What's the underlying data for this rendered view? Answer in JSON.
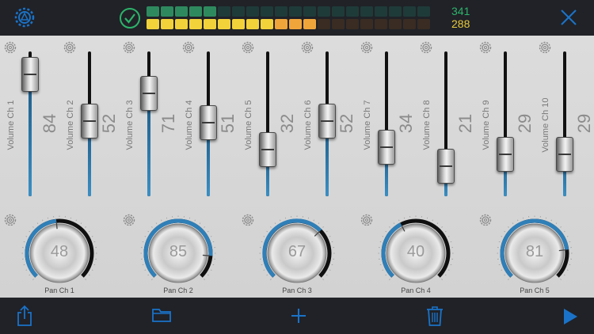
{
  "meter": {
    "top_value": "341",
    "bottom_value": "288",
    "top_count": 5,
    "bottom_count": 12,
    "segments": 20
  },
  "icons": {
    "settings": "settings-wheel-icon",
    "status": "check-circle-icon",
    "close": "close-icon"
  },
  "faders": [
    {
      "label": "Volume Ch 1",
      "value": "84",
      "level": 0.84
    },
    {
      "label": "Volume Ch 2",
      "value": "52",
      "level": 0.52
    },
    {
      "label": "Volume Ch 3",
      "value": "71",
      "level": 0.71
    },
    {
      "label": "Volume Ch 4",
      "value": "51",
      "level": 0.51
    },
    {
      "label": "Volume Ch 5",
      "value": "32",
      "level": 0.32
    },
    {
      "label": "Volume Ch 6",
      "value": "52",
      "level": 0.52
    },
    {
      "label": "Volume Ch 7",
      "value": "34",
      "level": 0.34
    },
    {
      "label": "Volume Ch 8",
      "value": "21",
      "level": 0.21
    },
    {
      "label": "Volume Ch 9",
      "value": "29",
      "level": 0.29
    },
    {
      "label": "Volume Ch 10",
      "value": "29",
      "level": 0.29
    }
  ],
  "knobs": [
    {
      "label": "Pan Ch 1",
      "value": "48",
      "level": 0.48
    },
    {
      "label": "Pan Ch 2",
      "value": "85",
      "level": 0.85
    },
    {
      "label": "Pan Ch 3",
      "value": "67",
      "level": 0.67
    },
    {
      "label": "Pan Ch 4",
      "value": "40",
      "level": 0.4
    },
    {
      "label": "Pan Ch 5",
      "value": "81",
      "level": 0.81
    }
  ],
  "toolbar": [
    "share-icon",
    "folder-icon",
    "add-icon",
    "trash-icon",
    "play-icon"
  ],
  "colors": {
    "accent": "#1a73c8",
    "fill": "#2f7fb8",
    "meter_top_on": "#2e8a5e",
    "meter_bottom_on": "#f2d23a"
  }
}
